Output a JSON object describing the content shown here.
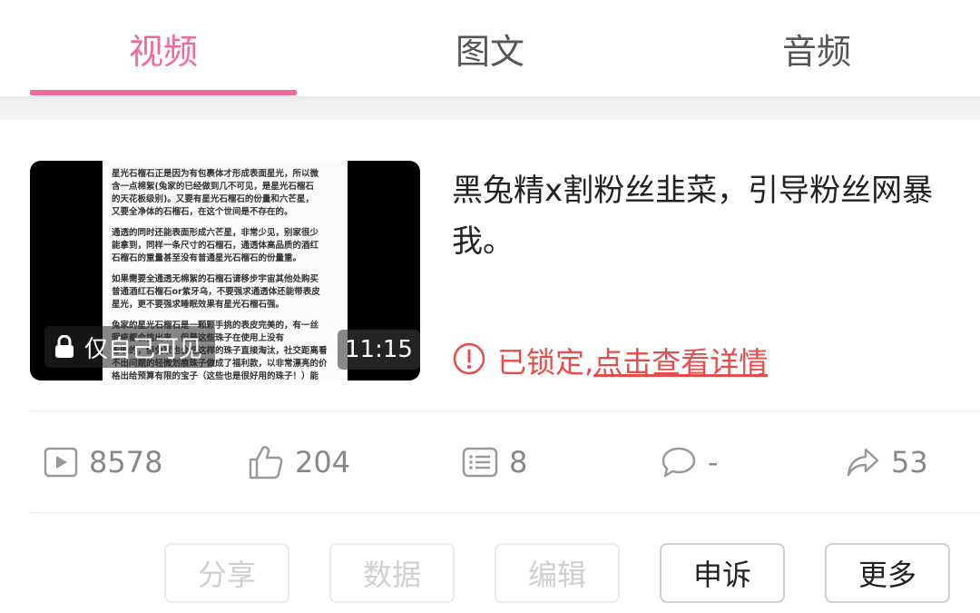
{
  "tabs": [
    {
      "label": "视频",
      "active": true
    },
    {
      "label": "图文",
      "active": false
    },
    {
      "label": "音频",
      "active": false
    }
  ],
  "accent_color": "#ef6a9a",
  "video": {
    "thumbnail_lines": [
      "星光石榴石正是因为有包裹体才形成表面星光，所以微",
      "含一点棉絮(兔家的已经做到几不可见，是星光石榴石",
      "的天花板级别)。又要有星光石榴石的份量和六芒星，",
      "又要全净体的石榴石，在这个世间是不存在的。",
      "",
      "通透的同时还能表面形成六芒星，非常少见，别家很少",
      "能拿到，同样一条尺寸的石榴石，通透体高品质的酒红",
      "石榴石的重量甚至没有普通星光石榴石的份量重。",
      "",
      "如果需要全通透无棉絮的石榴石请移步宇宙其他处购买",
      "普通酒红石榴石or紫牙乌，不要强求通透体还能带表皮",
      "星光，更不要强求睡眠效果有星光石榴石强。",
      "",
      "兔家的星光石榴石是一颗颗手挑的表皮完美的，有一丝",
      "瑕疵都会挑出来，但是这些珠子在使用上没有",
      "影响的，但兔家也会把这样的珠子直接淘汰，社交距离看",
      "不出问题的轻微划痕珠子做成了福利款，以非常漂亮的价",
      "格出给预算有限的宝子（这些也是很好用的珠子！）能"
    ],
    "visibility_label": "仅自己可见",
    "duration": "11:15",
    "title": "黑兔精x割粉丝韭菜，引导粉丝网暴我。",
    "locked_prefix": "已锁定,",
    "locked_link": "点击查看详情",
    "locked_color": "#e54c4c"
  },
  "stats": {
    "plays": "8578",
    "likes": "204",
    "list_count": "8",
    "comments": "-",
    "shares": "53"
  },
  "actions": [
    {
      "label": "分享",
      "enabled": false
    },
    {
      "label": "数据",
      "enabled": false
    },
    {
      "label": "编辑",
      "enabled": false
    },
    {
      "label": "申诉",
      "enabled": true
    },
    {
      "label": "更多",
      "enabled": true
    }
  ],
  "icons": [
    "lock-icon",
    "info-circle-icon",
    "play-icon",
    "thumbs-up-icon",
    "list-icon",
    "comment-icon",
    "share-icon"
  ]
}
